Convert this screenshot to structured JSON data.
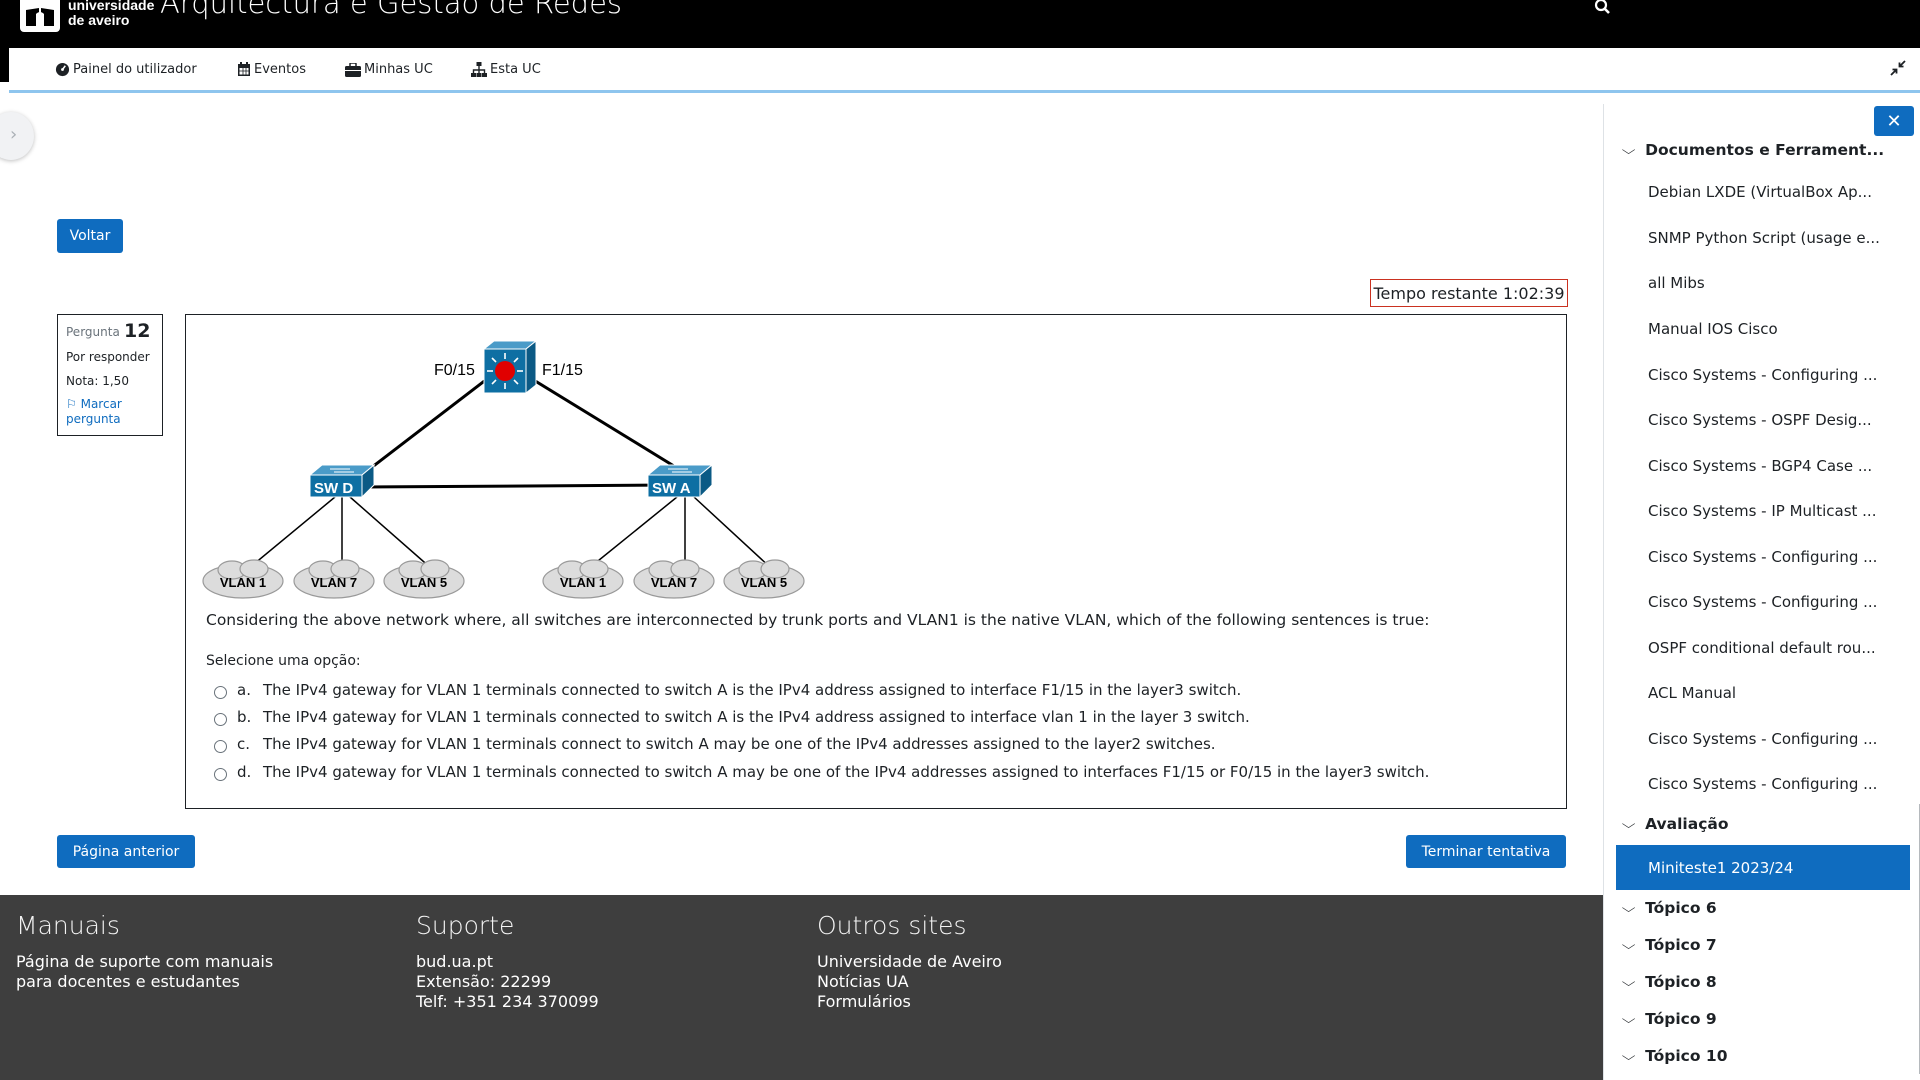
{
  "header": {
    "logo_line1": "universidade",
    "logo_line2": "de aveiro",
    "site_title": "Arquitectura e Gestão de Redes"
  },
  "nav": {
    "items": [
      {
        "label": "Painel do utilizador",
        "icon": "dashboard-icon"
      },
      {
        "label": "Eventos",
        "icon": "calendar-icon"
      },
      {
        "label": "Minhas UC",
        "icon": "briefcase-icon"
      },
      {
        "label": "Esta UC",
        "icon": "sitemap-icon"
      }
    ]
  },
  "buttons": {
    "back": "Voltar",
    "previous_page": "Página anterior",
    "finish_attempt": "Terminar tentativa"
  },
  "timer": {
    "text": "Tempo restante 1:02:39"
  },
  "question_info": {
    "label": "Pergunta",
    "number": "12",
    "state": "Por responder",
    "grade": "Nota: 1,50",
    "flag": "Marcar pergunta"
  },
  "diagram": {
    "left_port": "F0/15",
    "right_port": "F1/15",
    "switch_d": "SW D",
    "switch_a": "SW A",
    "vlans_left": [
      "VLAN 1",
      "VLAN 7",
      "VLAN 5"
    ],
    "vlans_right": [
      "VLAN 1",
      "VLAN 7",
      "VLAN 5"
    ]
  },
  "question": {
    "text": "Considering the above network where, all switches are interconnected by trunk ports and VLAN1 is the native VLAN, which of the following sentences is true:",
    "prompt": "Selecione uma opção:",
    "options": [
      {
        "letter": "a.",
        "text": "The IPv4 gateway for VLAN 1 terminals connected to switch A is the IPv4 address assigned to interface F1/15 in the layer3 switch."
      },
      {
        "letter": "b.",
        "text": "The IPv4 gateway for VLAN 1 terminals connected to switch A is the IPv4 address assigned to interface vlan 1 in the layer 3 switch."
      },
      {
        "letter": "c.",
        "text": "The IPv4 gateway for VLAN 1 terminals connect to switch A may be one of the IPv4 addresses assigned to the layer2 switches."
      },
      {
        "letter": "d.",
        "text": "The IPv4 gateway for VLAN 1 terminals connected to switch A may be one of the IPv4 addresses assigned to interfaces F1/15 or F0/15 in the layer3 switch."
      }
    ]
  },
  "footer": {
    "col1": {
      "title": "Manuais",
      "lines": [
        "Página de suporte com manuais",
        "para docentes e estudantes"
      ]
    },
    "col2": {
      "title": "Suporte",
      "lines": [
        "bud.ua.pt",
        "Extensão: 22299",
        "Telf: +351 234 370099"
      ]
    },
    "col3": {
      "title": "Outros sites",
      "lines": [
        "Universidade de Aveiro",
        "Notícias UA",
        "Formulários"
      ]
    }
  },
  "drawer": {
    "close": "✕",
    "section_docs": "Documentos e Ferrament...",
    "items": [
      "Debian LXDE (VirtualBox Ap...",
      "SNMP Python Script (usage e...",
      "all Mibs",
      "Manual IOS Cisco",
      "Cisco Systems - Configuring ...",
      "Cisco Systems - OSPF Desig...",
      "Cisco Systems - BGP4 Case ...",
      "Cisco Systems - IP Multicast ...",
      "Cisco Systems - Configuring ...",
      "Cisco Systems - Configuring ...",
      "OSPF conditional default rou...",
      "ACL Manual",
      "Cisco Systems - Configuring ...",
      "Cisco Systems - Configuring ..."
    ],
    "section_eval": "Avaliação",
    "active_item": "Miniteste1 2023/24",
    "topics": [
      "Tópico 6",
      "Tópico 7",
      "Tópico 8",
      "Tópico 9",
      "Tópico 10"
    ]
  },
  "colors": {
    "primary": "#0f6cbf",
    "footer_bg": "#3e3e3e",
    "timer_border": "#ca3120",
    "nav_underline": "#8ec5ee"
  }
}
